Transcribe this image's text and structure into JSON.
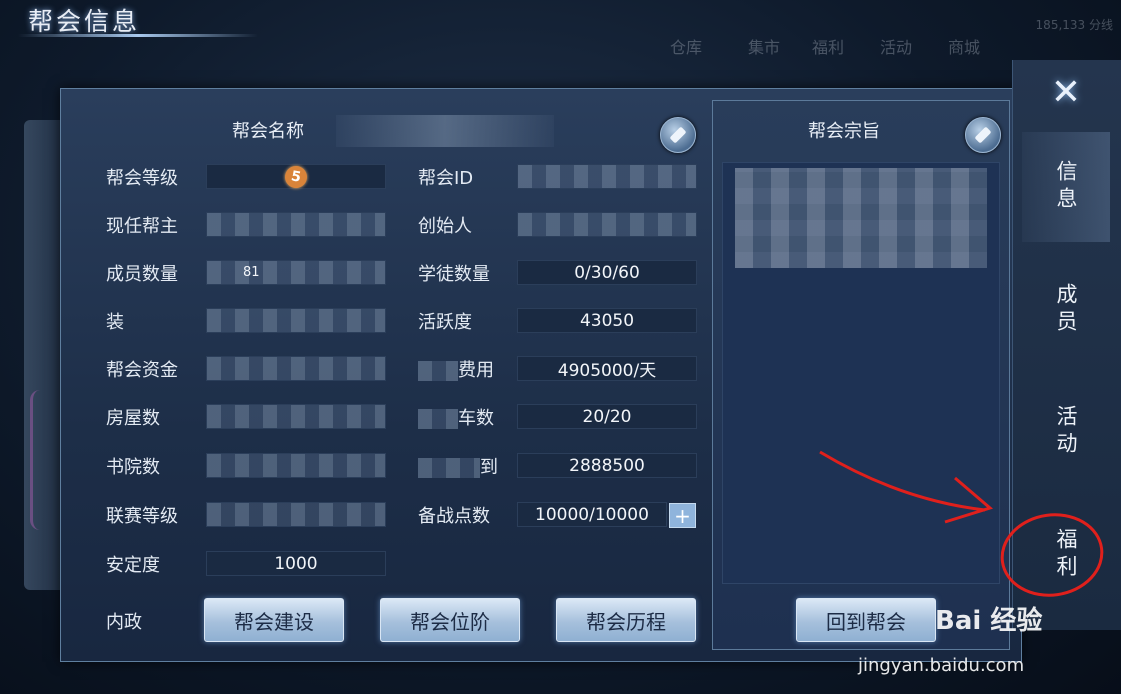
{
  "window": {
    "title": "帮会信息"
  },
  "background_menu": [
    "仓库",
    "集市",
    "福利",
    "活动",
    "商城"
  ],
  "background_coords": "185,133 分线",
  "guild": {
    "name_label": "帮会名称",
    "purpose_title": "帮会宗旨",
    "left_rows": [
      {
        "label": "帮会等级",
        "value": "5",
        "kind": "level"
      },
      {
        "label": "现任帮主",
        "value": "",
        "kind": "blur"
      },
      {
        "label": "成员数量",
        "value": "81",
        "kind": "blur"
      },
      {
        "label": "装",
        "value": "",
        "kind": "blur"
      },
      {
        "label": "帮会资金",
        "value": "",
        "kind": "blur"
      },
      {
        "label": "房屋数",
        "value": "",
        "kind": "blur"
      },
      {
        "label": "书院数",
        "value": "",
        "kind": "blur"
      },
      {
        "label": "联赛等级",
        "value": "",
        "kind": "blur"
      },
      {
        "label": "安定度",
        "value": "1000",
        "kind": "text"
      }
    ],
    "right_rows": [
      {
        "label": "帮会ID",
        "value": ""
      },
      {
        "label": "创始人",
        "value": ""
      },
      {
        "label": "学徒数量",
        "value": "0/30/60"
      },
      {
        "label": "活跃度",
        "value": "43050"
      },
      {
        "label": "费用",
        "value": "4905000/天"
      },
      {
        "label": "车数",
        "value": "20/20"
      },
      {
        "label": "到",
        "value": "2888500"
      },
      {
        "label": "备战点数",
        "value": "10000/10000"
      }
    ],
    "interior_label": "内政",
    "buttons": [
      "帮会建设",
      "帮会位阶",
      "帮会历程"
    ],
    "return_button": "回到帮会"
  },
  "tabs": [
    {
      "label": "信息",
      "active": true
    },
    {
      "label": "成员",
      "active": false
    },
    {
      "label": "活动",
      "active": false
    },
    {
      "label": "福利",
      "active": false
    }
  ],
  "watermark": {
    "text": "Bai 经验",
    "url": "jingyan.baidu.com"
  },
  "colors": {
    "annotation": "#e0201c",
    "accent": "#8fb4dc"
  }
}
